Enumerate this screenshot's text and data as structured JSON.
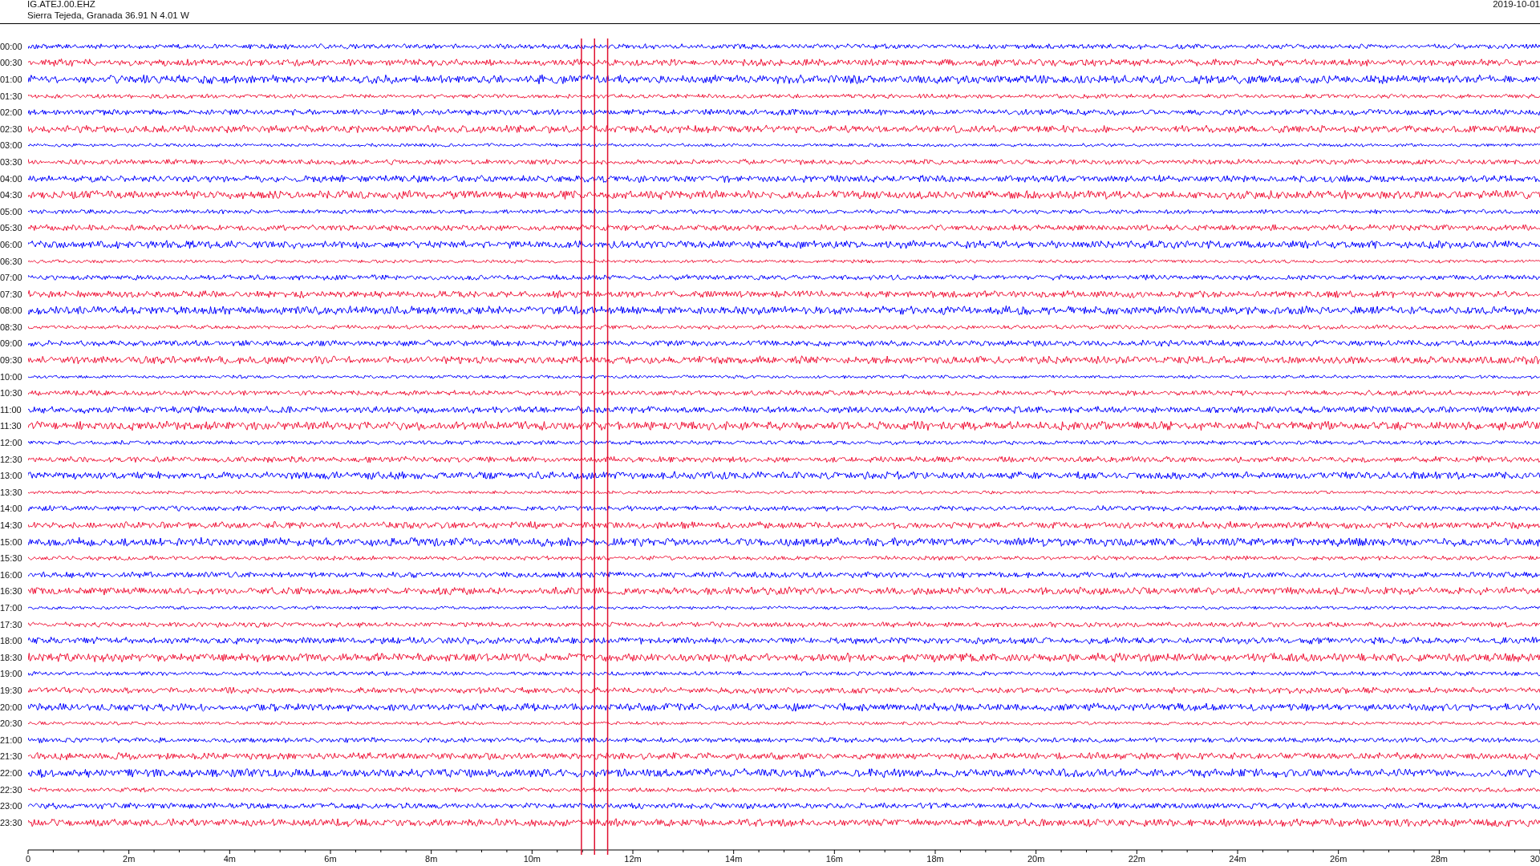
{
  "header": {
    "station": "IG.ATEJ.00.EHZ",
    "location": "Sierra Tejeda, Granada  36.91 N 4.01 W",
    "date": "2019-10-01"
  },
  "rows": [
    {
      "label": "00:00",
      "color": "#0000ff"
    },
    {
      "label": "00:30",
      "color": "#f01438"
    },
    {
      "label": "01:00",
      "color": "#0000ff"
    },
    {
      "label": "01:30",
      "color": "#f01438"
    },
    {
      "label": "02:00",
      "color": "#0000ff"
    },
    {
      "label": "02:30",
      "color": "#f01438"
    },
    {
      "label": "03:00",
      "color": "#0000ff"
    },
    {
      "label": "03:30",
      "color": "#f01438"
    },
    {
      "label": "04:00",
      "color": "#0000ff"
    },
    {
      "label": "04:30",
      "color": "#f01438"
    },
    {
      "label": "05:00",
      "color": "#0000ff"
    },
    {
      "label": "05:30",
      "color": "#f01438"
    },
    {
      "label": "06:00",
      "color": "#0000ff"
    },
    {
      "label": "06:30",
      "color": "#f01438"
    },
    {
      "label": "07:00",
      "color": "#0000ff"
    },
    {
      "label": "07:30",
      "color": "#f01438"
    },
    {
      "label": "08:00",
      "color": "#0000ff"
    },
    {
      "label": "08:30",
      "color": "#f01438"
    },
    {
      "label": "09:00",
      "color": "#0000ff"
    },
    {
      "label": "09:30",
      "color": "#f01438"
    },
    {
      "label": "10:00",
      "color": "#0000ff"
    },
    {
      "label": "10:30",
      "color": "#f01438"
    },
    {
      "label": "11:00",
      "color": "#0000ff"
    },
    {
      "label": "11:30",
      "color": "#f01438"
    },
    {
      "label": "12:00",
      "color": "#0000ff"
    },
    {
      "label": "12:30",
      "color": "#f01438"
    },
    {
      "label": "13:00",
      "color": "#0000ff"
    },
    {
      "label": "13:30",
      "color": "#f01438"
    },
    {
      "label": "14:00",
      "color": "#0000ff"
    },
    {
      "label": "14:30",
      "color": "#f01438"
    },
    {
      "label": "15:00",
      "color": "#0000ff"
    },
    {
      "label": "15:30",
      "color": "#f01438"
    },
    {
      "label": "16:00",
      "color": "#0000ff"
    },
    {
      "label": "16:30",
      "color": "#f01438"
    },
    {
      "label": "17:00",
      "color": "#0000ff"
    },
    {
      "label": "17:30",
      "color": "#f01438"
    },
    {
      "label": "18:00",
      "color": "#0000ff"
    },
    {
      "label": "18:30",
      "color": "#f01438"
    },
    {
      "label": "19:00",
      "color": "#0000ff"
    },
    {
      "label": "19:30",
      "color": "#f01438"
    },
    {
      "label": "20:00",
      "color": "#0000ff"
    },
    {
      "label": "20:30",
      "color": "#f01438"
    },
    {
      "label": "21:00",
      "color": "#0000ff"
    },
    {
      "label": "21:30",
      "color": "#f01438"
    },
    {
      "label": "22:00",
      "color": "#0000ff"
    },
    {
      "label": "22:30",
      "color": "#f01438"
    },
    {
      "label": "23:00",
      "color": "#0000ff"
    },
    {
      "label": "23:30",
      "color": "#f01438"
    }
  ],
  "x_axis": {
    "tick_labels": [
      "0",
      "2m",
      "4m",
      "6m",
      "8m",
      "10m",
      "12m",
      "14m",
      "16m",
      "18m",
      "20m",
      "22m",
      "24m",
      "26m",
      "28m",
      "30"
    ]
  }
}
